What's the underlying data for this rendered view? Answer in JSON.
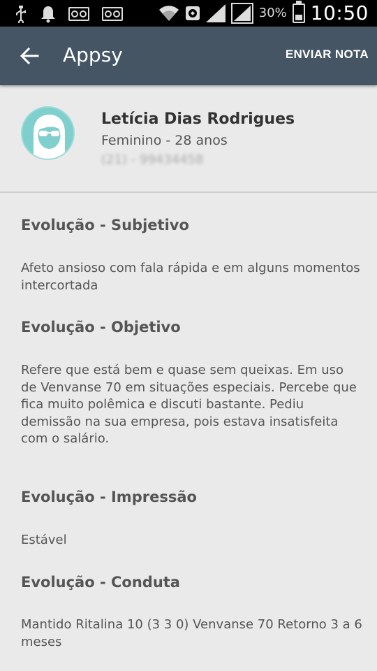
{
  "status_bar": {
    "battery_percent": "30%",
    "time": "10:50",
    "icons_left": [
      "usb-icon",
      "notification-bell-icon",
      "voicemail-icon",
      "voicemail-icon"
    ],
    "icons_right": [
      "wifi-icon",
      "sync-icon",
      "signal-icon",
      "signal-icon",
      "battery-charging-icon"
    ]
  },
  "app_bar": {
    "title": "Appsy",
    "action_label": "ENVIAR NOTA",
    "color": "#455563"
  },
  "patient": {
    "name": "Letícia Dias Rodrigues",
    "meta": "Feminino - 28 anos",
    "phone": "(21) - 99434458",
    "avatar_color": "#7fcfcd"
  },
  "sections": [
    {
      "title": "Evolução - Subjetivo",
      "text": "Afeto ansioso com fala rápida e em alguns momentos intercortada"
    },
    {
      "title": "Evolução - Objetivo",
      "text": "Refere que está bem e quase sem queixas. Em uso de Venvanse 70 em situações especiais. Percebe que fica muito polêmica e discuti bastante. Pediu demissão na sua empresa, pois estava insatisfeita com o salário."
    },
    {
      "title": "Evolução - Impressão",
      "text": "Estável"
    },
    {
      "title": "Evolução - Conduta",
      "text": "Mantido Ritalina 10 (3 3 0) Venvanse 70 Retorno 3 a 6 meses"
    }
  ]
}
